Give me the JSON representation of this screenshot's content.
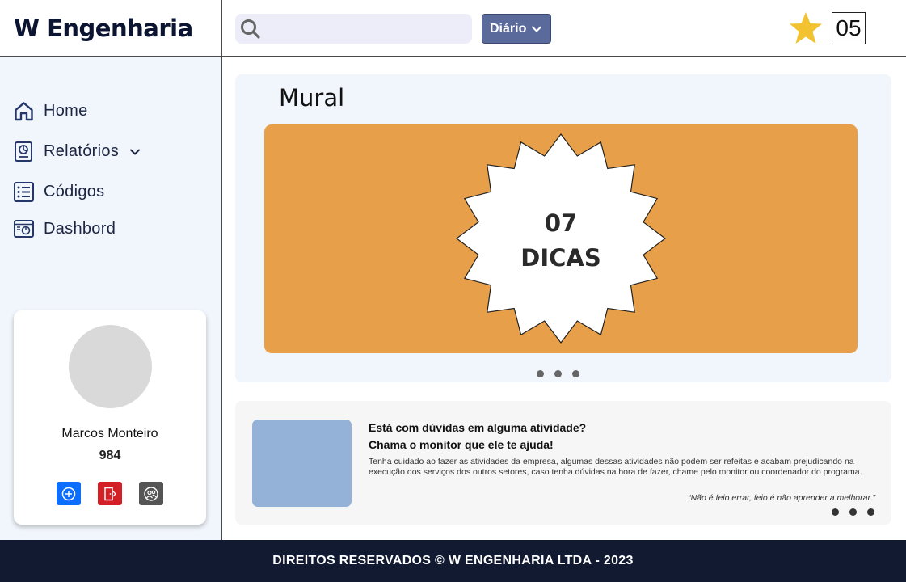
{
  "brand": {
    "name": "W Engenharia"
  },
  "topbar": {
    "search": {
      "placeholder": "",
      "value": ""
    },
    "period_label": "Diário",
    "score": "05"
  },
  "sidebar": {
    "items": [
      {
        "label": "Home",
        "icon": "home-icon"
      },
      {
        "label": "Relatórios",
        "icon": "report-icon",
        "has_submenu": true
      },
      {
        "label": "Códigos",
        "icon": "list-icon"
      },
      {
        "label": "Dashbord",
        "icon": "dashboard-icon"
      }
    ]
  },
  "profile": {
    "name": "Marcos Monteiro",
    "id": "984",
    "actions": [
      {
        "icon": "add-icon",
        "color": "#0d6efd"
      },
      {
        "icon": "logout-icon",
        "color": "#d32026"
      },
      {
        "icon": "users-icon",
        "color": "#555555"
      }
    ]
  },
  "mural": {
    "title": "Mural",
    "banner": {
      "number": "07",
      "word": "DICAS",
      "color": "#e89f49"
    },
    "slides": 3
  },
  "tips": {
    "question1": "Está com dúvidas em alguma atividade?",
    "question2": "Chama o monitor que ele te ajuda!",
    "body": "Tenha cuidado ao fazer as atividades da empresa, algumas dessas atividades não podem ser refeitas e acabam prejudicando na execução dos serviços dos outros setores, caso tenha dúvidas na hora de fazer, chame pelo monitor ou coordenador do programa.",
    "quote": "“Não é feio errar, feio é não aprender a melhorar.”",
    "slides": 3
  },
  "footer": {
    "text": "DIREITOS RESERVADOS © W ENGENHARIA LTDA - 2023"
  },
  "colors": {
    "dark_navy": "#111a30",
    "accent": "#5a6a9b",
    "star": "#f2c230"
  }
}
